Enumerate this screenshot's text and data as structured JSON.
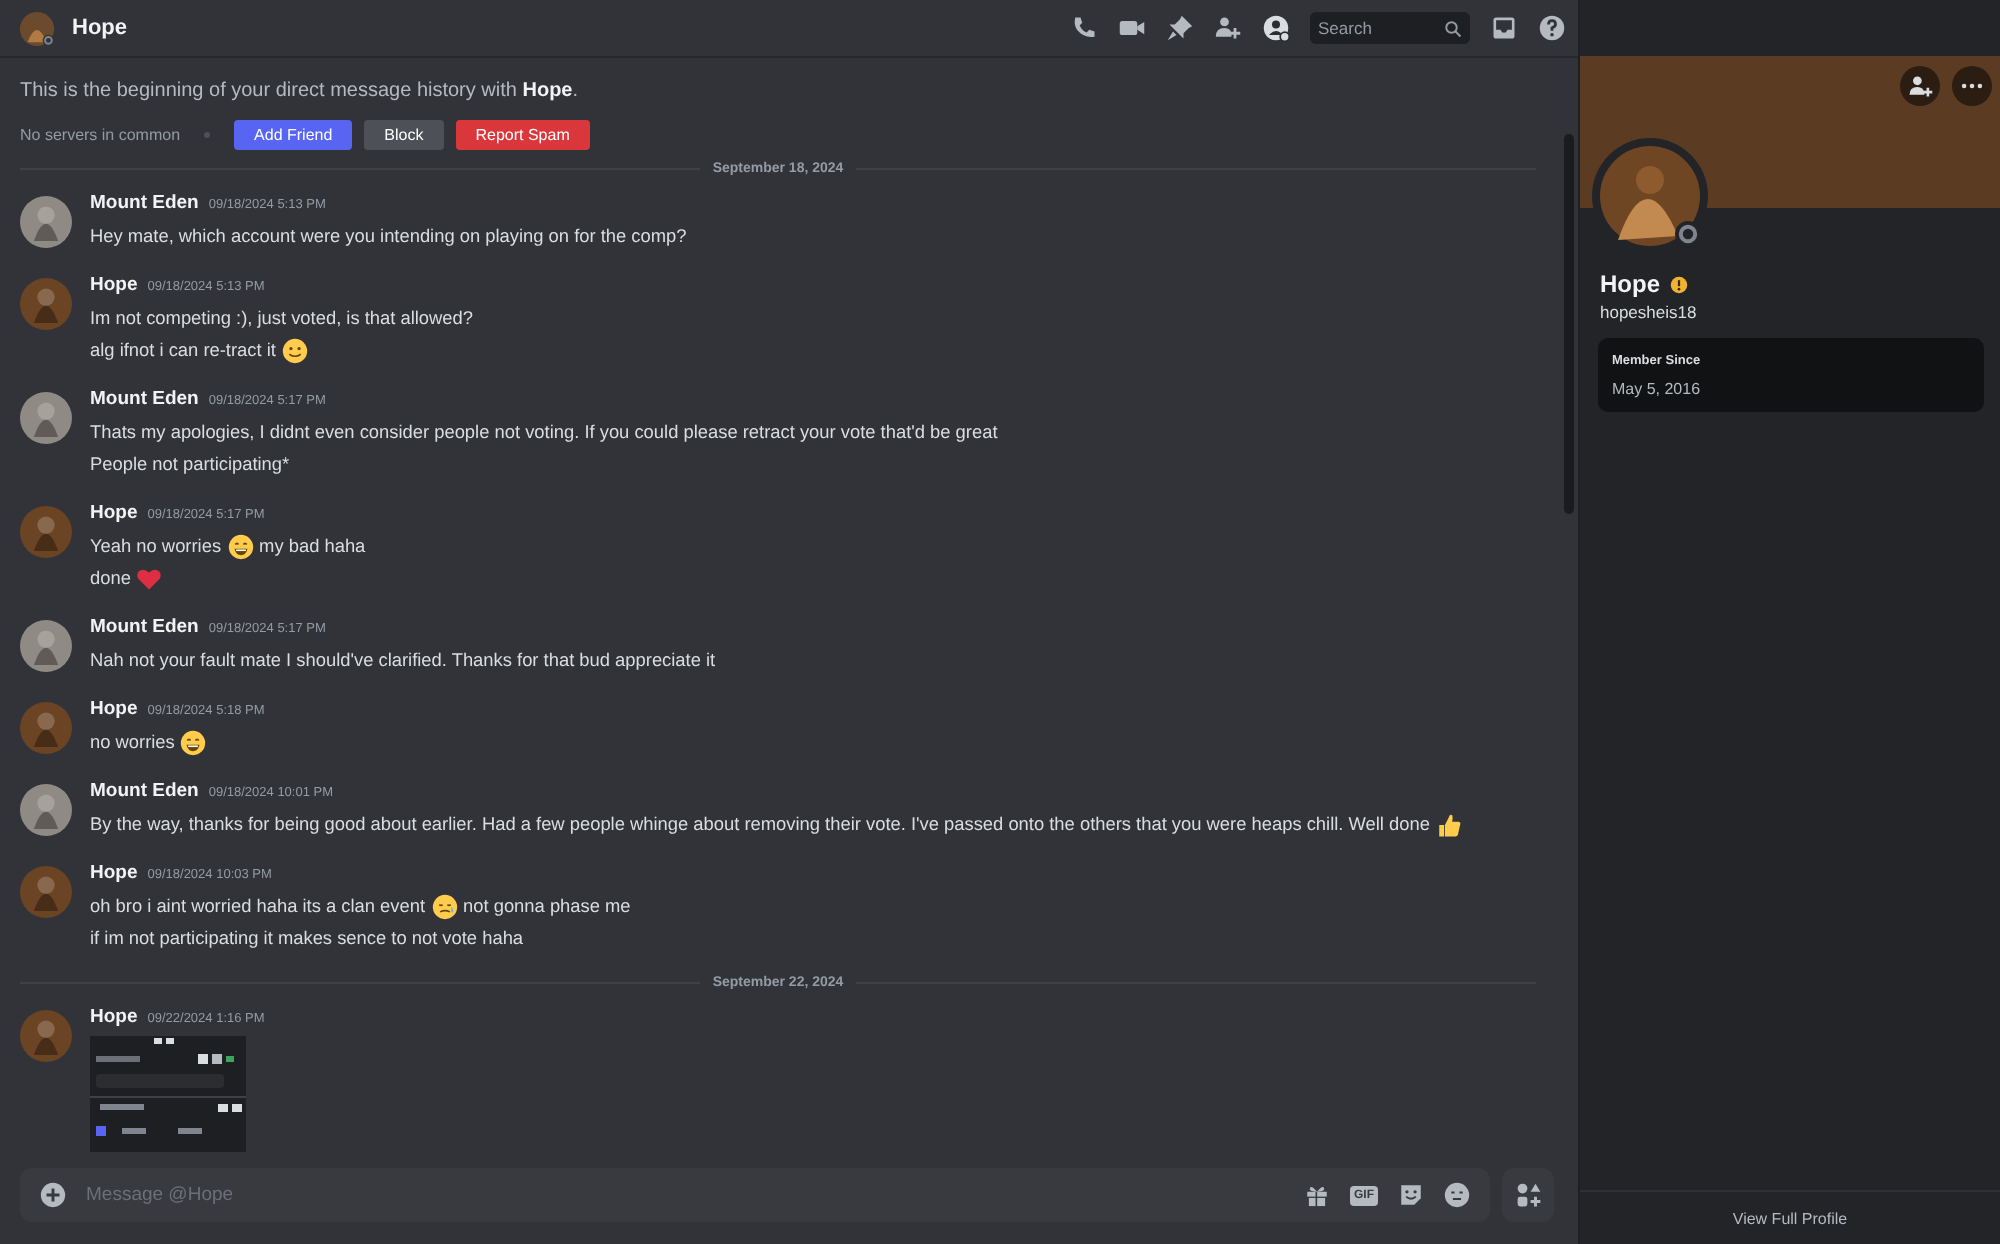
{
  "header": {
    "title": "Hope",
    "search": {
      "placeholder": "Search"
    }
  },
  "intro": {
    "text": "This is the beginning of your direct message history with **Hope**.",
    "servers": "No servers in common",
    "buttons": [
      {
        "label": "Add Friend",
        "kind": "primary"
      },
      {
        "label": "Block",
        "kind": "secondary"
      },
      {
        "label": "Report Spam",
        "kind": "danger"
      }
    ]
  },
  "timeline": [
    {
      "kind": "divider",
      "label": "September 18, 2024"
    },
    {
      "kind": "message",
      "author": "Mount Eden",
      "color": "#8f8b84",
      "time": "09/18/2024 5:13 PM",
      "lines": [
        [
          {
            "kind": "text",
            "text": "Hey mate, which account were you intending on playing on for the comp?"
          }
        ]
      ]
    },
    {
      "kind": "message",
      "author": "Hope",
      "color": "#6b4424",
      "time": "09/18/2024 5:13 PM",
      "lines": [
        [
          {
            "kind": "text",
            "text": "Im not competing :), just voted, is that allowed?"
          }
        ],
        [
          {
            "kind": "text",
            "text": "alg ifnot i can re-tract it"
          },
          {
            "kind": "smile"
          }
        ]
      ]
    },
    {
      "kind": "message",
      "author": "Mount Eden",
      "color": "#8f8b84",
      "time": "09/18/2024 5:17 PM",
      "lines": [
        [
          {
            "kind": "text",
            "text": "Thats my apologies, I didnt even consider people not voting. If you could please retract your vote that'd be great"
          }
        ],
        [
          {
            "kind": "text",
            "text": "People not participating*"
          }
        ]
      ]
    },
    {
      "kind": "message",
      "author": "Hope",
      "color": "#6b4424",
      "time": "09/18/2024 5:17 PM",
      "lines": [
        [
          {
            "kind": "text",
            "text": "Yeah no worries"
          },
          {
            "kind": "grin"
          },
          {
            "kind": "text",
            "text": "my bad haha"
          }
        ],
        [
          {
            "kind": "text",
            "text": "done"
          },
          {
            "kind": "heart"
          }
        ]
      ]
    },
    {
      "kind": "message",
      "author": "Mount Eden",
      "color": "#8f8b84",
      "time": "09/18/2024 5:17 PM",
      "lines": [
        [
          {
            "kind": "text",
            "text": "Nah not your fault mate I should've clarified. Thanks for that bud appreciate it"
          }
        ]
      ]
    },
    {
      "kind": "message",
      "author": "Hope",
      "color": "#6b4424",
      "time": "09/18/2024 5:18 PM",
      "lines": [
        [
          {
            "kind": "text",
            "text": "no worries"
          },
          {
            "kind": "grin"
          }
        ]
      ]
    },
    {
      "kind": "message",
      "author": "Mount Eden",
      "color": "#8f8b84",
      "time": "09/18/2024 10:01 PM",
      "lines": [
        [
          {
            "kind": "text",
            "text": "By the way, thanks for being good about earlier. Had a few people whinge about removing their vote. I've passed onto the others that you were heaps chill. Well done"
          },
          {
            "kind": "thumb"
          }
        ]
      ]
    },
    {
      "kind": "message",
      "author": "Hope",
      "color": "#6b4424",
      "time": "09/18/2024 10:03 PM",
      "lines": [
        [
          {
            "kind": "text",
            "text": "oh bro i aint worried haha its a clan event"
          },
          {
            "kind": "tear"
          },
          {
            "kind": "text",
            "text": "not gonna phase me"
          }
        ],
        [
          {
            "kind": "text",
            "text": "if im not participating it makes sence to not vote haha"
          }
        ]
      ]
    },
    {
      "kind": "divider",
      "label": "September 22, 2024"
    },
    {
      "kind": "message",
      "author": "Hope",
      "color": "#6b4424",
      "time": "09/22/2024 1:16 PM"
    }
  ],
  "composer": {
    "placeholder": "Message @Hope",
    "gif_label": "GIF"
  },
  "profile": {
    "name": "Hope",
    "username": "hopesheis18",
    "member_since_label": "Member Since",
    "member_since": "May 5, 2016",
    "footer": "View Full Profile"
  }
}
